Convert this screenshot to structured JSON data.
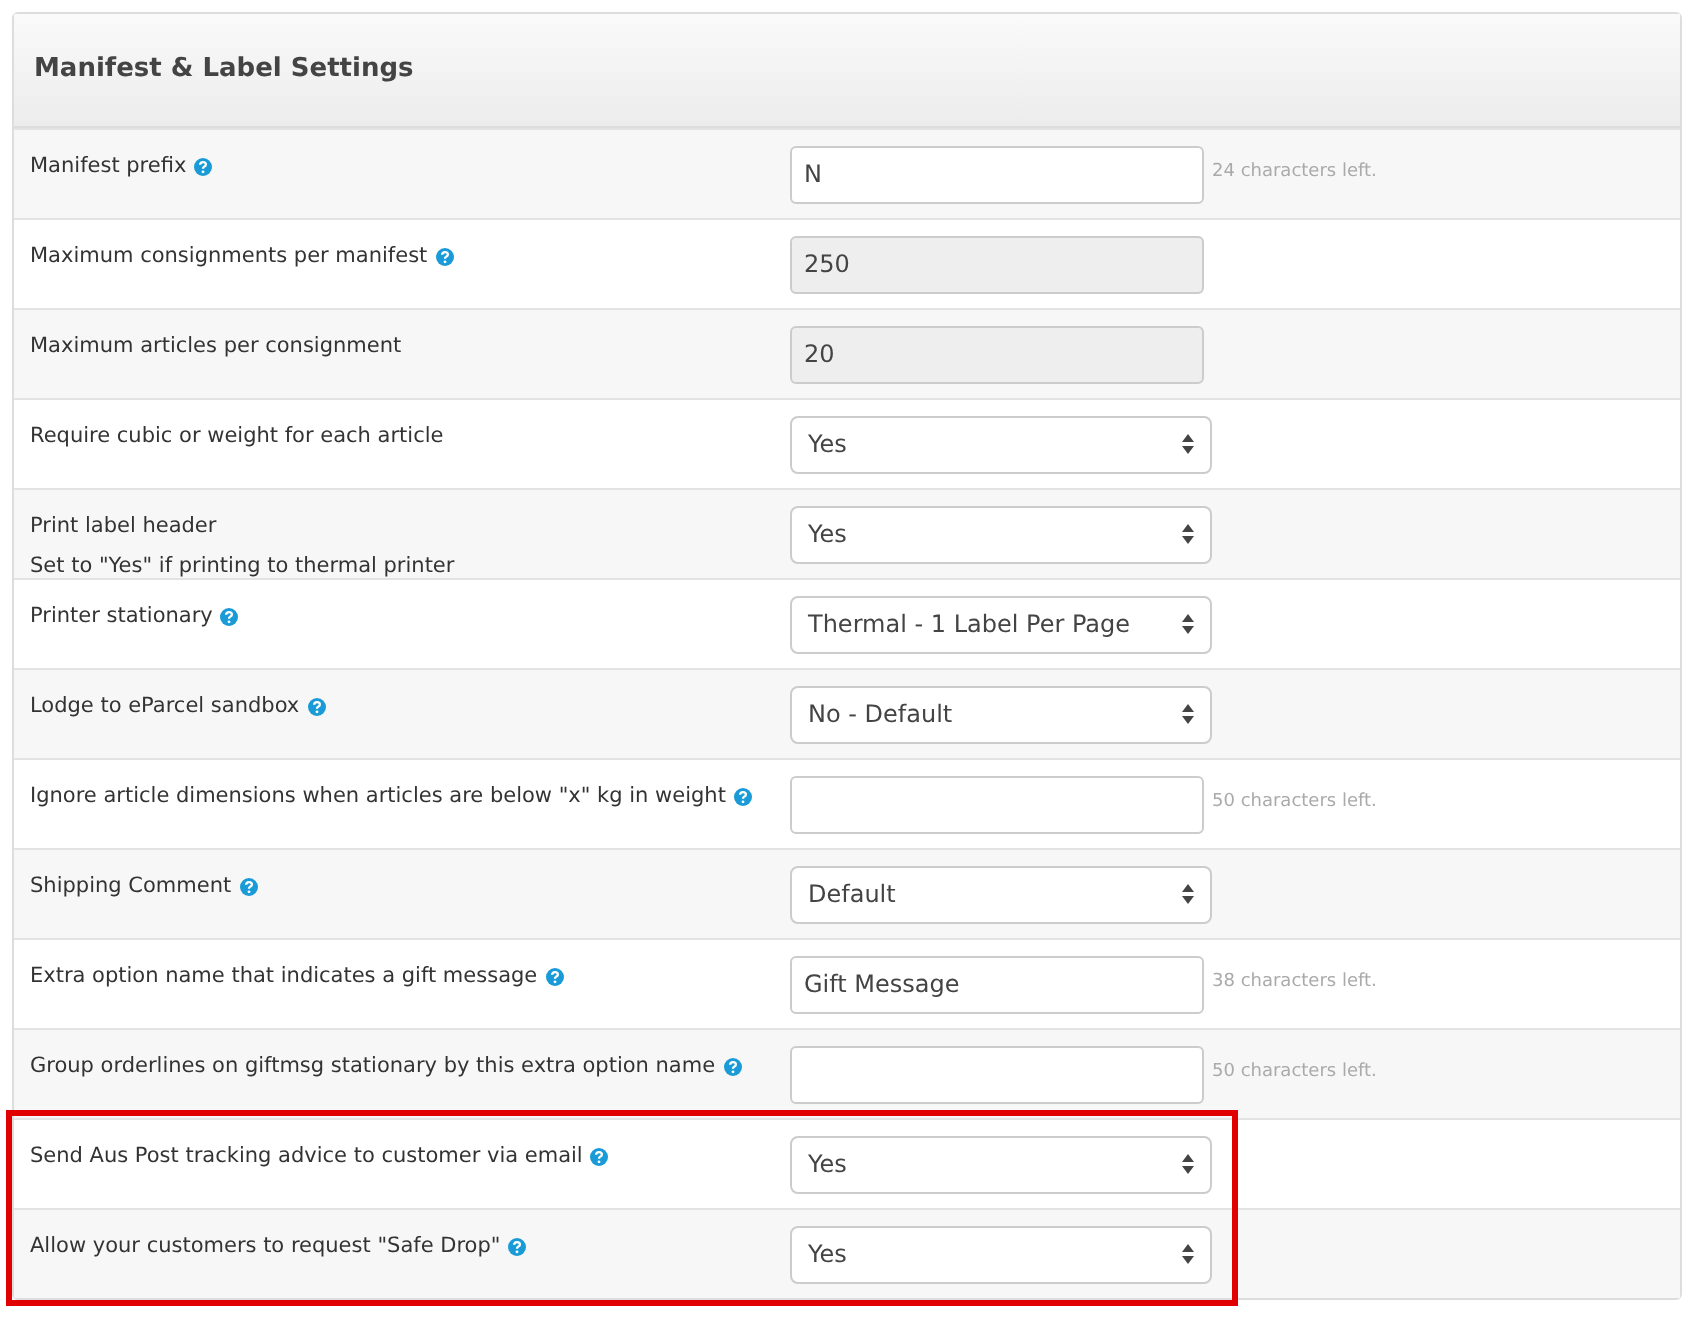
{
  "panel": {
    "title": "Manifest & Label Settings"
  },
  "rows": [
    {
      "label": "Manifest prefix",
      "help": true,
      "highlighted": false,
      "field": {
        "kind": "text",
        "value": "N",
        "disabled": false,
        "counter": "24 characters left."
      }
    },
    {
      "label": "Maximum consignments per manifest",
      "help": true,
      "highlighted": false,
      "field": {
        "kind": "text",
        "value": "250",
        "disabled": true
      }
    },
    {
      "label": "Maximum articles per consignment",
      "help": false,
      "highlighted": false,
      "field": {
        "kind": "text",
        "value": "20",
        "disabled": true
      }
    },
    {
      "label": "Require cubic or weight for each article",
      "help": false,
      "highlighted": false,
      "field": {
        "kind": "select",
        "value": "Yes"
      }
    },
    {
      "label": "Print label header",
      "note": "Set to \"Yes\" if printing to thermal printer",
      "help": false,
      "highlighted": false,
      "field": {
        "kind": "select",
        "value": "Yes"
      }
    },
    {
      "label": "Printer stationary",
      "help": true,
      "highlighted": false,
      "field": {
        "kind": "select",
        "value": "Thermal - 1 Label Per Page"
      }
    },
    {
      "label": "Lodge to eParcel sandbox",
      "help": true,
      "highlighted": false,
      "field": {
        "kind": "select",
        "value": "No - Default"
      }
    },
    {
      "label": "Ignore article dimensions when articles are below \"x\" kg in weight",
      "help": true,
      "highlighted": false,
      "field": {
        "kind": "text",
        "disabled": false,
        "counter": "50 characters left."
      }
    },
    {
      "label": "Shipping Comment",
      "help": true,
      "highlighted": false,
      "field": {
        "kind": "select",
        "value": "Default"
      }
    },
    {
      "label": "Extra option name that indicates a gift message",
      "help": true,
      "highlighted": false,
      "field": {
        "kind": "text",
        "value": "Gift Message",
        "disabled": false,
        "counter": "38 characters left."
      }
    },
    {
      "label": "Group orderlines on giftmsg stationary by this extra option name",
      "help": true,
      "highlighted": false,
      "field": {
        "kind": "text",
        "disabled": false,
        "counter": "50 characters left."
      }
    },
    {
      "label": "Send Aus Post tracking advice to customer via email",
      "help": true,
      "highlighted": true,
      "field": {
        "kind": "select",
        "value": "Yes"
      }
    },
    {
      "label": "Allow your customers to request \"Safe Drop\"",
      "help": true,
      "highlighted": true,
      "field": {
        "kind": "select",
        "value": "Yes"
      }
    }
  ]
}
